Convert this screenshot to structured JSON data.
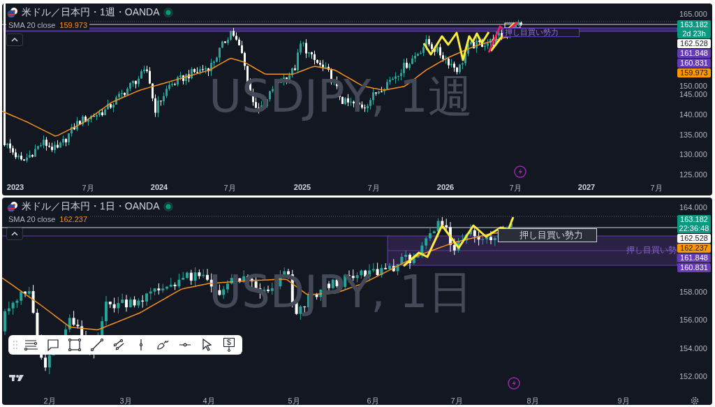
{
  "charts": [
    {
      "title": "米ドル／日本円・1週・OANDA",
      "indicator": {
        "name": "SMA 20 close",
        "value": "159.973"
      },
      "watermark": "USDJPY, 1週",
      "price_ticks": [
        "165.000",
        "150.000",
        "145.000",
        "140.000",
        "135.000",
        "130.000",
        "125.000"
      ],
      "price_badges": [
        {
          "kind": "last",
          "value": "163.182",
          "sub": "2d 23h"
        },
        {
          "kind": "line",
          "value": "162.528"
        },
        {
          "kind": "zone",
          "value": "161.848"
        },
        {
          "kind": "zone",
          "value": "160.831"
        },
        {
          "kind": "sma",
          "value": "159.973"
        }
      ],
      "zone_labels": [
        {
          "kind": "purple-box",
          "text": "押し目買い勢力"
        }
      ],
      "time_ticks": [
        {
          "label": "2023",
          "major": true
        },
        {
          "label": "7月",
          "major": false
        },
        {
          "label": "2024",
          "major": true
        },
        {
          "label": "7月",
          "major": false
        },
        {
          "label": "2025",
          "major": true
        },
        {
          "label": "7月",
          "major": false
        },
        {
          "label": "2026",
          "major": true
        },
        {
          "label": "7月",
          "major": false
        },
        {
          "label": "2027",
          "major": true
        },
        {
          "label": "7月",
          "major": false
        }
      ]
    },
    {
      "title": "米ドル／日本円・1日・OANDA",
      "indicator": {
        "name": "SMA 20 close",
        "value": "162.237"
      },
      "watermark": "USDJPY, 1日",
      "price_ticks": [
        "164.000",
        "158.000",
        "156.000",
        "154.000",
        "152.000"
      ],
      "price_badges": [
        {
          "kind": "last",
          "value": "163.182",
          "sub": "22:36:48"
        },
        {
          "kind": "line",
          "value": "162.528"
        },
        {
          "kind": "sma",
          "value": "162.237"
        },
        {
          "kind": "zone",
          "value": "161.848"
        },
        {
          "kind": "zone",
          "value": "160.831"
        }
      ],
      "zone_labels": [
        {
          "kind": "white-box",
          "text": "押し目買い勢力"
        },
        {
          "kind": "purple-text",
          "text": "押し目買い勢"
        }
      ],
      "drawing_toolbar": {
        "price_glyph": "$"
      },
      "time_ticks": [
        {
          "label": "2月",
          "major": false
        },
        {
          "label": "3月",
          "major": false
        },
        {
          "label": "4月",
          "major": false
        },
        {
          "label": "5月",
          "major": false
        },
        {
          "label": "6月",
          "major": false
        },
        {
          "label": "7月",
          "major": false
        },
        {
          "label": "8月",
          "major": false
        },
        {
          "label": "9月",
          "major": false
        }
      ]
    }
  ]
}
